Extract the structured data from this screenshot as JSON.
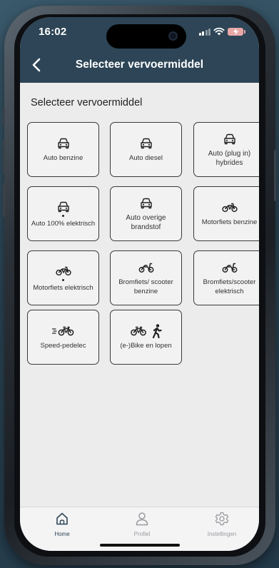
{
  "status_bar": {
    "time": "16:02"
  },
  "header": {
    "title": "Selecteer vervoermiddel"
  },
  "main": {
    "section_title": "Selecteer vervoermiddel",
    "options": [
      {
        "label": "Auto benzine",
        "icon": "car-icon"
      },
      {
        "label": "Auto diesel",
        "icon": "car-icon"
      },
      {
        "label": "Auto (plug in) hybrides",
        "icon": "car-icon"
      },
      {
        "label": "Auto 100% elektrisch",
        "icon": "car-icon"
      },
      {
        "label": "Auto overige brandstof",
        "icon": "car-icon"
      },
      {
        "label": "Motorfiets benzine",
        "icon": "motorcycle-icon"
      },
      {
        "label": "Motorfiets elektrisch",
        "icon": "motorcycle-icon"
      },
      {
        "label": "Bromfiets/ scooter benzine",
        "icon": "scooter-icon"
      },
      {
        "label": "Bromfiets/scooter elektrisch",
        "icon": "scooter-icon"
      },
      {
        "label": "Speed-pedelec",
        "icon": "speed-bike-icon"
      },
      {
        "label": "(e-)Bike en lopen",
        "icon": "bike-walk-icon"
      }
    ]
  },
  "tabbar": {
    "tabs": [
      {
        "label": "Home",
        "icon": "home-icon",
        "active": true
      },
      {
        "label": "Profiel",
        "icon": "person-icon",
        "active": false
      },
      {
        "label": "Instellingen",
        "icon": "gear-icon",
        "active": false
      }
    ]
  },
  "colors": {
    "header_bg": "#2d4556",
    "active_tab": "#2d4556",
    "inactive_tab": "#9a9a9f"
  }
}
